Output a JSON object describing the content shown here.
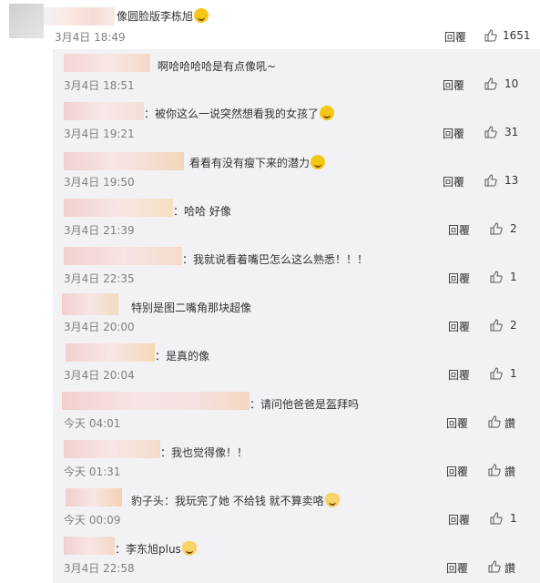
{
  "main_comment": {
    "text": "像圆脸版李栋旭",
    "emoji": "laugh-cry-emoji",
    "time": "3月4日 18:49",
    "reply_label": "回覆",
    "likes": "1651"
  },
  "replies": [
    {
      "text": "啊哈哈哈哈是有点像吼~",
      "emoji": "",
      "time": "3月4日 18:51",
      "reply_label": "回覆",
      "likes": "10"
    },
    {
      "text": "：被你这么一说突然想看我的女孩了",
      "emoji": "laugh-cry-emoji",
      "time": "3月4日 19:21",
      "reply_label": "回覆",
      "likes": "31"
    },
    {
      "text": "看看有没有瘦下来的潜力",
      "emoji": "laugh-cry-emoji",
      "time": "3月4日 19:50",
      "reply_label": "回覆",
      "likes": "13"
    },
    {
      "text": "：哈哈 好像",
      "emoji": "",
      "time": "3月4日 21:39",
      "reply_label": "回覆",
      "likes": "2"
    },
    {
      "text": "：我就说看着嘴巴怎么这么熟悉！！！",
      "emoji": "",
      "time": "3月4日 22:35",
      "reply_label": "回覆",
      "likes": "1"
    },
    {
      "text": "特别是图二嘴角那块超像",
      "emoji": "",
      "time": "3月4日 20:00",
      "reply_label": "回覆",
      "likes": "2"
    },
    {
      "text": "：是真的像",
      "emoji": "",
      "time": "3月4日 20:04",
      "reply_label": "回覆",
      "likes": "1"
    },
    {
      "text": "：请问他爸爸是盔拜吗",
      "emoji": "",
      "time": "今天 04:01",
      "reply_label": "回覆",
      "likes": "讚"
    },
    {
      "text": "：我也觉得像！！",
      "emoji": "",
      "time": "今天 01:31",
      "reply_label": "回覆",
      "likes": "讚"
    },
    {
      "text": "豹子头：我玩完了她 不给钱 就不算卖咯",
      "emoji": "cat-emoji",
      "time": "今天 00:09",
      "reply_label": "回覆",
      "likes": "1"
    },
    {
      "text": "：李东旭plus",
      "emoji": "cat-emoji",
      "time": "3月4日 22:58",
      "reply_label": "回覆",
      "likes": "讚"
    }
  ]
}
